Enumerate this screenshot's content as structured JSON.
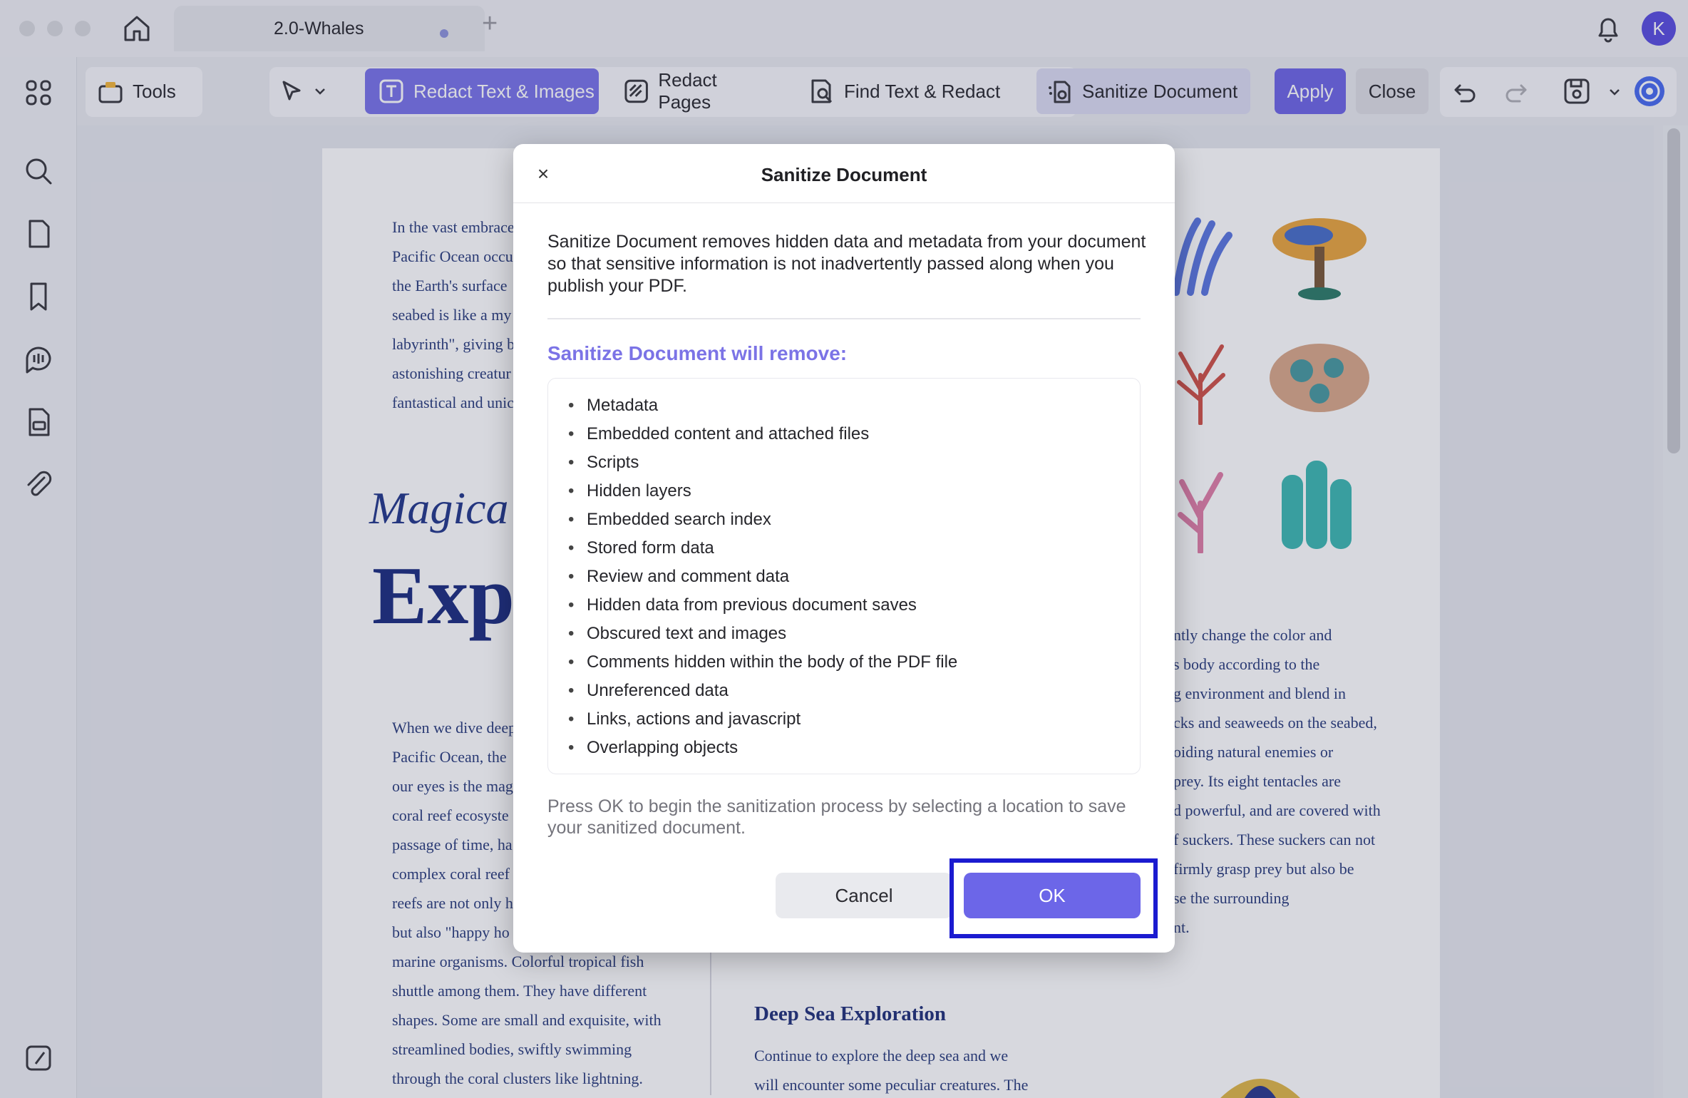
{
  "window": {
    "tab_title": "2.0-Whales",
    "new_tab": "+",
    "avatar_initial": "K"
  },
  "toolbar": {
    "tools_label": "Tools",
    "redact_text_images": "Redact Text & Images",
    "redact_pages": "Redact Pages",
    "find_text_redact": "Find Text & Redact",
    "sanitize_document": "Sanitize Document",
    "apply": "Apply",
    "close": "Close"
  },
  "page": {
    "col1_top": [
      "In the vast embrace",
      "Pacific Ocean occu",
      "the Earth's surface",
      "seabed is like a my",
      "labyrinth\", giving b",
      "astonishing creatur",
      "fantastical and unic"
    ],
    "heading_italic": "Magica",
    "heading_big": "Exp",
    "col1_bottom": [
      "When we dive deep",
      "Pacific Ocean, the",
      "our eyes is the mag",
      "coral reef ecosyste",
      "passage of time, ha",
      "complex coral reef",
      "reefs are not only h",
      "but also \"happy ho",
      "marine organisms. Colorful tropical fish",
      "shuttle among them. They have different",
      "shapes. Some are small and exquisite, with",
      "streamlined bodies, swiftly swimming",
      "through the coral clusters like lightning."
    ],
    "col3_text": [
      "ntly change the color and",
      "s body according to the",
      "g environment and blend in",
      "cks and seaweeds on the seabed,",
      "oiding natural enemies or",
      "prey. Its eight tentacles are",
      "d powerful, and are covered with",
      "f suckers. These suckers can not",
      "firmly grasp prey but also be",
      "se the surrounding",
      "nt."
    ],
    "sub_heading": "Deep Sea Exploration",
    "col2_bottom": [
      "Continue to explore the deep sea and we",
      "will encounter some peculiar creatures. The"
    ]
  },
  "dialog": {
    "close_glyph": "×",
    "title": "Sanitize Document",
    "description": "Sanitize Document removes hidden data and metadata from your document so that sensitive information is not inadvertently passed along when you publish your PDF.",
    "subtitle": "Sanitize Document will remove:",
    "items": [
      "Metadata",
      "Embedded content and attached files",
      "Scripts",
      "Hidden layers",
      "Embedded search index",
      "Stored form data",
      "Review and comment data",
      "Hidden data from previous document saves",
      "Obscured text and images",
      "Comments hidden within the body of the PDF file",
      "Unreferenced data",
      "Links, actions and javascript",
      "Overlapping objects"
    ],
    "note": "Press OK to begin the sanitization process by selecting a location to save your sanitized document.",
    "cancel_label": "Cancel",
    "ok_label": "OK"
  },
  "colors": {
    "accent": "#6c66e8",
    "highlight_border": "#1b1bd0"
  }
}
